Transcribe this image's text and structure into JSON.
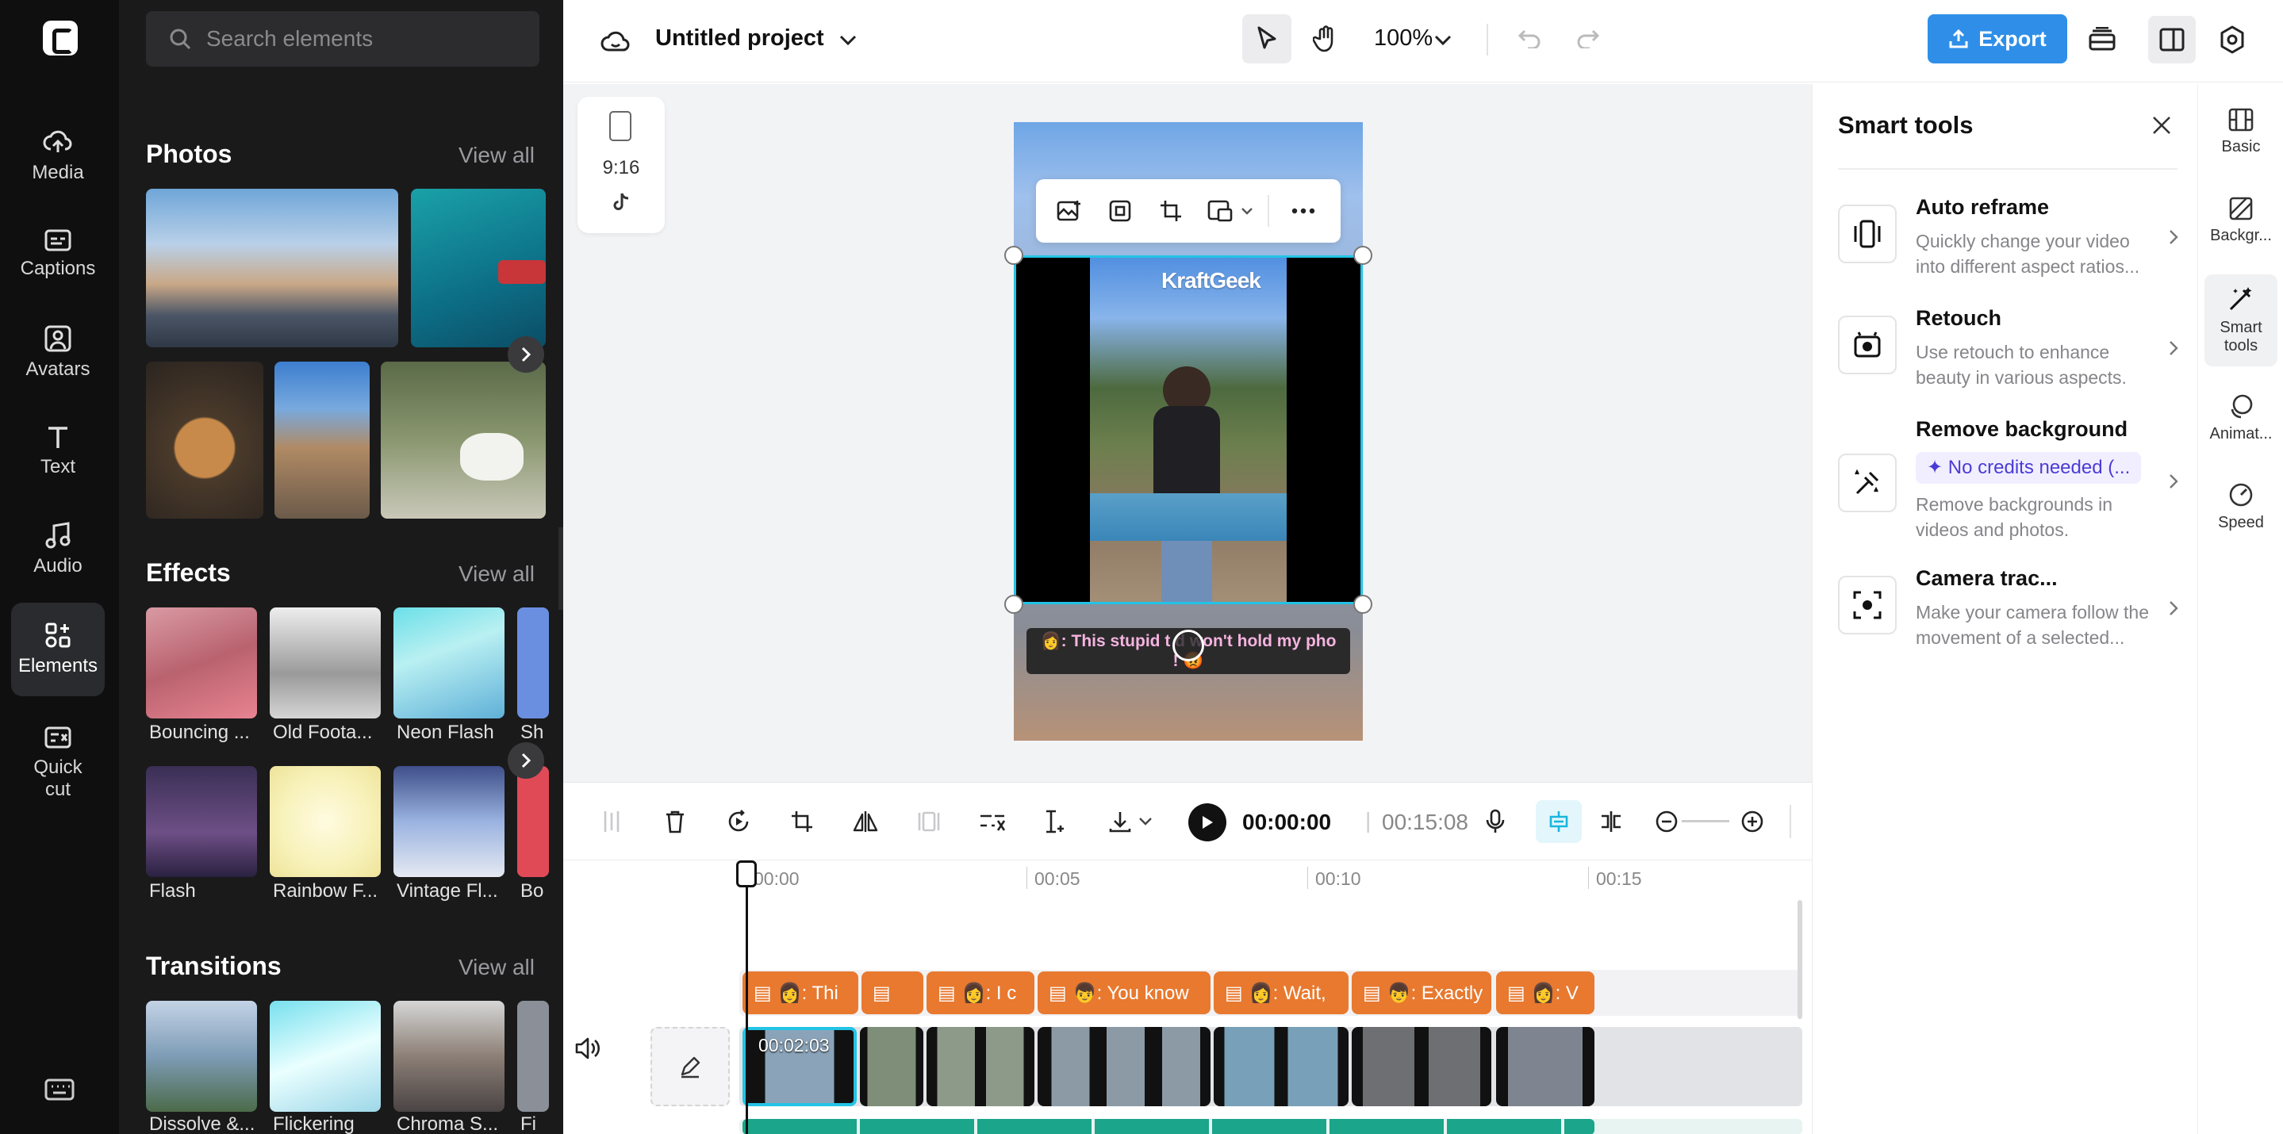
{
  "sidebar": {
    "items": [
      {
        "label": "Media",
        "icon": "cloud-upload-icon"
      },
      {
        "label": "Captions",
        "icon": "captions-icon"
      },
      {
        "label": "Avatars",
        "icon": "avatar-icon"
      },
      {
        "label": "Text",
        "icon": "text-icon"
      },
      {
        "label": "Audio",
        "icon": "music-icon"
      },
      {
        "label": "Elements",
        "icon": "elements-icon",
        "active": true
      },
      {
        "label": "Quick cut",
        "icon": "quick-cut-icon"
      }
    ]
  },
  "elements_panel": {
    "search_placeholder": "Search elements",
    "photos": {
      "title": "Photos",
      "view_all": "View all"
    },
    "effects": {
      "title": "Effects",
      "view_all": "View all",
      "items": [
        "Bouncing ...",
        "Old Foota...",
        "Neon Flash",
        "Sh",
        "Flash",
        "Rainbow F...",
        "Vintage Fl...",
        "Bo"
      ]
    },
    "transitions": {
      "title": "Transitions",
      "view_all": "View all",
      "items": [
        "Dissolve &...",
        "Flickering",
        "Chroma S...",
        "Fi"
      ]
    }
  },
  "topbar": {
    "project_title": "Untitled project",
    "zoom": "100%",
    "export_label": "Export"
  },
  "canvas": {
    "aspect_ratio": "9:16",
    "watermark": "KraftGeek",
    "caption_text": "👩: This stupid tripod won't hold my phone! 😡",
    "caption_visible": "👩: This stupid t    d won't hold my pho   ! 😡"
  },
  "timeline": {
    "current_time": "00:00:00",
    "total_time": "00:15:08",
    "ruler": [
      "00:00",
      "00:05",
      "00:10",
      "00:15"
    ],
    "first_clip_duration": "00:02:03",
    "caption_clips": [
      "👩: Thi",
      "",
      "👩: I c",
      "👦: You know",
      "👩: Wait,",
      "👦: Exactly",
      "👩: V"
    ]
  },
  "smart_tools": {
    "title": "Smart tools",
    "tools": [
      {
        "title": "Auto reframe",
        "desc": "Quickly change your video into different aspect ratios..."
      },
      {
        "title": "Retouch",
        "desc": "Use retouch to enhance beauty in various aspects."
      },
      {
        "title": "Remove background",
        "badge": "✦ No credits needed (...",
        "desc": "Remove backgrounds in videos and photos."
      },
      {
        "title": "Camera trac...",
        "desc": "Make your camera follow the movement of a selected..."
      }
    ]
  },
  "right_tabs": [
    "Basic",
    "Backgr...",
    "Smart tools",
    "Animat...",
    "Speed"
  ],
  "colors": {
    "accent": "#2f8fe8",
    "selection": "#22c3e6",
    "caption_clip": "#e8792f",
    "sidebar_bg": "#0f0f10",
    "panel_bg": "#1a1a1b"
  }
}
